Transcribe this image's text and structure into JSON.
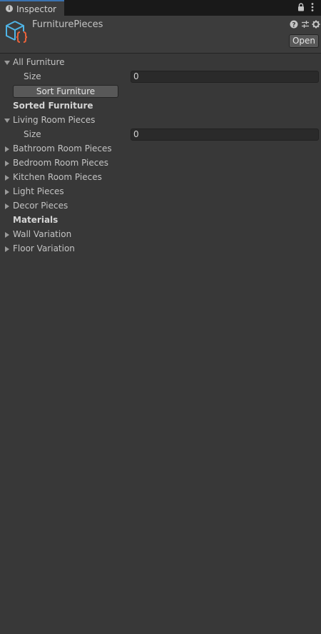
{
  "tab": {
    "info_glyph": "i",
    "title": "Inspector",
    "lock_icon": "lock-icon",
    "menu_icon": "kebab-menu-icon"
  },
  "header": {
    "asset_name": "FurniturePieces",
    "asset_icon": "scriptable-object-icon",
    "help_icon": "help-icon",
    "presets_icon": "presets-icon",
    "settings_icon": "gear-icon",
    "open_label": "Open"
  },
  "properties": {
    "all_furniture": {
      "label": "All Furniture",
      "expanded": true
    },
    "all_furniture_size": {
      "label": "Size",
      "value": "0"
    },
    "sort_button": {
      "label": "Sort Furniture"
    },
    "sorted_furniture": {
      "label": "Sorted Furniture"
    },
    "living_room": {
      "label": "Living Room Pieces",
      "expanded": true
    },
    "living_room_size": {
      "label": "Size",
      "value": "0"
    },
    "bathroom": {
      "label": "Bathroom Room Pieces",
      "expanded": false
    },
    "bedroom": {
      "label": "Bedroom Room Pieces",
      "expanded": false
    },
    "kitchen": {
      "label": "Kitchen Room Pieces",
      "expanded": false
    },
    "light": {
      "label": "Light Pieces",
      "expanded": false
    },
    "decor": {
      "label": "Decor Pieces",
      "expanded": false
    },
    "materials": {
      "label": "Materials"
    },
    "wall_variation": {
      "label": "Wall Variation",
      "expanded": false
    },
    "floor_variation": {
      "label": "Floor Variation",
      "expanded": false
    }
  },
  "colors": {
    "background": "#383838",
    "tab_accent": "#3a72b0",
    "icon_blue": "#4fb4e6",
    "icon_orange": "#e8623a"
  }
}
